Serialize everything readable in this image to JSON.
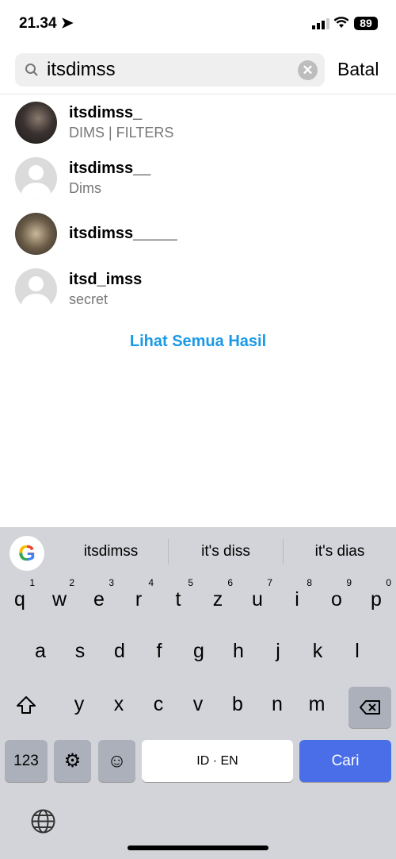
{
  "status": {
    "time": "21.34",
    "battery": "89"
  },
  "search": {
    "value": "itsdimss",
    "cancel": "Batal"
  },
  "results": [
    {
      "username": "itsdimss_",
      "subtitle": "DIMS | FILTERS",
      "avatar": "photo"
    },
    {
      "username": "itsdimss__",
      "subtitle": "Dims",
      "avatar": "default"
    },
    {
      "username": "itsdimss_____",
      "subtitle": "",
      "avatar": "photo2"
    },
    {
      "username": "itsd_imss",
      "subtitle": "secret",
      "avatar": "default"
    }
  ],
  "see_all": "Lihat Semua Hasil",
  "keyboard": {
    "google": "G",
    "suggestions": [
      "itsdimss",
      "it's diss",
      "it's dias"
    ],
    "row1": [
      "q",
      "w",
      "e",
      "r",
      "t",
      "z",
      "u",
      "i",
      "o",
      "p"
    ],
    "row1_hints": [
      "1",
      "2",
      "3",
      "4",
      "5",
      "6",
      "7",
      "8",
      "9",
      "0"
    ],
    "row2": [
      "a",
      "s",
      "d",
      "f",
      "g",
      "h",
      "j",
      "k",
      "l"
    ],
    "row3": [
      "y",
      "x",
      "c",
      "v",
      "b",
      "n",
      "m"
    ],
    "numbers": "123",
    "space": "ID · EN",
    "action": "Cari",
    "action_color": "#4a6ee8"
  }
}
